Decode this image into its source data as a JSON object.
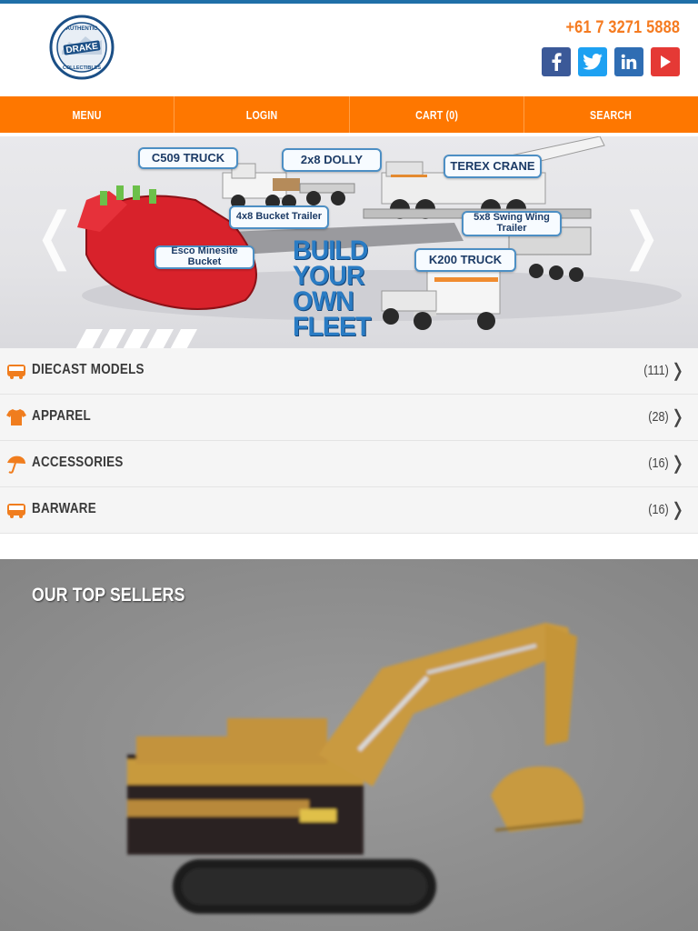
{
  "header": {
    "phone": "+61 7 3271 5888",
    "logo": {
      "top_text": "AUTHENTIC",
      "brand": "DRAKE",
      "bottom_text": "COLLECTIBLES"
    },
    "socials": [
      {
        "name": "facebook",
        "glyph": "f",
        "color": "#3b5998"
      },
      {
        "name": "twitter",
        "glyph": "t",
        "color": "#1da1f2"
      },
      {
        "name": "linkedin",
        "glyph": "in",
        "color": "#2f6db3"
      },
      {
        "name": "youtube",
        "glyph": "▶",
        "color": "#e53935"
      }
    ]
  },
  "nav": {
    "items": [
      "MENU",
      "LOGIN",
      "CART (0)",
      "SEARCH"
    ]
  },
  "hero": {
    "prev": "❬",
    "next": "❭",
    "callouts": {
      "c509": "C509 TRUCK",
      "dolly": "2x8 DOLLY",
      "terex": "TEREX CRANE",
      "bucket_trailer": "4x8 Bucket Trailer",
      "swing_wing": "5x8 Swing Wing Trailer",
      "esco": "Esco Minesite Bucket",
      "k200": "K200 TRUCK"
    },
    "headline": [
      "BUILD",
      "YOUR",
      "OWN",
      "FLEET"
    ]
  },
  "categories": [
    {
      "label": "DIECAST MODELS",
      "count": "(111)",
      "icon": "bus-icon"
    },
    {
      "label": "APPAREL",
      "count": "(28)",
      "icon": "tshirt-icon"
    },
    {
      "label": "ACCESSORIES",
      "count": "(16)",
      "icon": "umbrella-icon"
    },
    {
      "label": "BARWARE",
      "count": "(16)",
      "icon": "bus-icon"
    }
  ],
  "chevron": "❭",
  "top_sellers": {
    "title": "OUR TOP SELLERS"
  },
  "colors": {
    "accent": "#fe7700",
    "nav_text": "#ffffff",
    "brand_blue": "#1f6fa8"
  }
}
